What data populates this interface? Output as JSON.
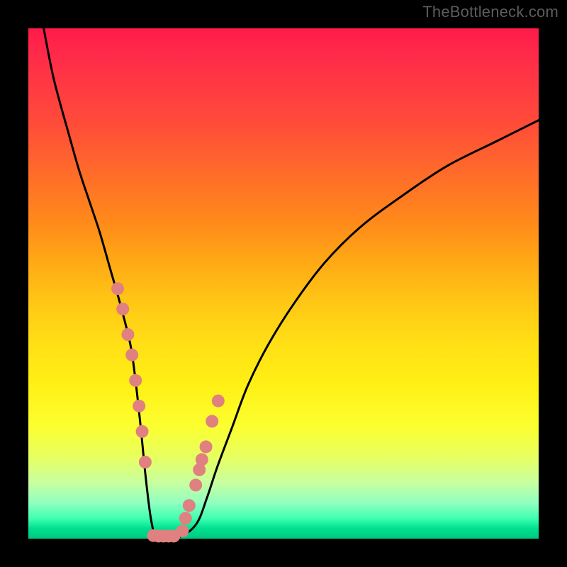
{
  "watermark": "TheBottleneck.com",
  "chart_data": {
    "type": "line",
    "title": "",
    "xlabel": "",
    "ylabel": "",
    "xlim": [
      0,
      100
    ],
    "ylim": [
      0,
      100
    ],
    "series": [
      {
        "name": "curve",
        "x": [
          3,
          5,
          8,
          10,
          12,
          14,
          16,
          18,
          20,
          21,
          22,
          23,
          24,
          25,
          27,
          30,
          33,
          35,
          37,
          40,
          43,
          47,
          52,
          58,
          65,
          73,
          82,
          92,
          100
        ],
        "values": [
          100,
          90,
          79,
          72,
          66,
          60,
          53,
          46,
          38,
          31,
          22,
          12,
          4,
          0.5,
          0.3,
          0.5,
          3,
          8,
          14,
          22,
          30,
          38,
          46,
          54,
          61,
          67,
          73,
          78,
          82
        ]
      }
    ],
    "markers": {
      "name": "threshold-dots",
      "color": "#e08080",
      "radius_px": 9,
      "x": [
        17.5,
        18.5,
        19.5,
        20.3,
        21,
        21.7,
        22.3,
        22.9,
        24.5,
        25.5,
        26.5,
        27.5,
        28.5,
        30.2,
        30.8,
        31.5,
        32.8,
        33.5,
        34,
        34.8,
        36,
        37.2
      ],
      "values": [
        49,
        45,
        40,
        36,
        31,
        26,
        21,
        15,
        0.6,
        0.5,
        0.5,
        0.5,
        0.5,
        1.5,
        4,
        6.5,
        10.5,
        13.5,
        15.5,
        18,
        23,
        27
      ]
    }
  }
}
